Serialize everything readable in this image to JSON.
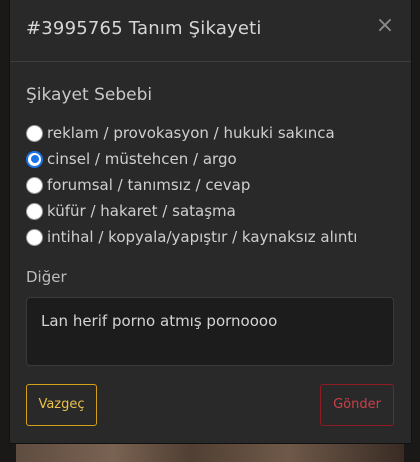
{
  "modal": {
    "title": "#3995765 Tanım Şikayeti",
    "close_icon": "close-icon",
    "close_glyph": "×"
  },
  "complaint": {
    "section_title": "Şikayet Sebebi",
    "reasons": [
      {
        "label": "reklam / provokasyon / hukuki sakınca",
        "checked": false
      },
      {
        "label": "cinsel / müstehcen / argo",
        "checked": true
      },
      {
        "label": "forumsal / tanımsız / cevap",
        "checked": false
      },
      {
        "label": "küfür / hakaret / sataşma",
        "checked": false
      },
      {
        "label": "intihal / kopyala/yapıştır / kaynaksız alıntı",
        "checked": false
      }
    ],
    "selected_index": 1,
    "other_label": "Diğer",
    "other_value": "Lan herif porno atmış pornoooo"
  },
  "actions": {
    "cancel_label": "Vazgeç",
    "send_label": "Gönder"
  },
  "colors": {
    "cancel_accent": "#d4a017",
    "send_accent": "#8e1b22",
    "radio_checked": "#1a73e8"
  }
}
